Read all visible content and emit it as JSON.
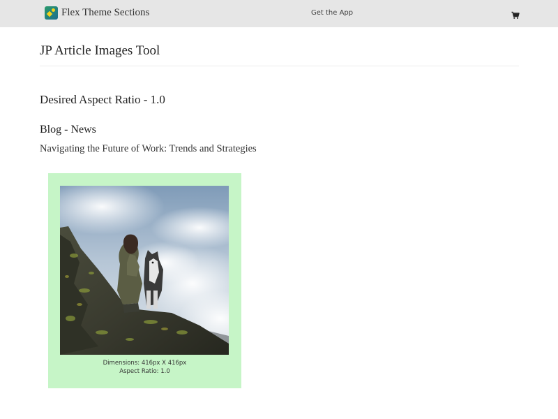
{
  "header": {
    "brand_name": "Flex Theme Sections",
    "get_app_label": "Get the App",
    "cart_icon": "cart-icon"
  },
  "main": {
    "page_title": "JP Article Images Tool",
    "aspect_heading": "Desired Aspect Ratio - 1.0",
    "blog_heading": "Blog - News",
    "article_title": "Navigating the Future of Work: Trends and Strategies"
  },
  "image_card": {
    "dimensions_label": "Dimensions: 416px X 416px",
    "aspect_ratio_label": "Aspect Ratio: 1.0",
    "background_color": "#c6f5c7"
  }
}
